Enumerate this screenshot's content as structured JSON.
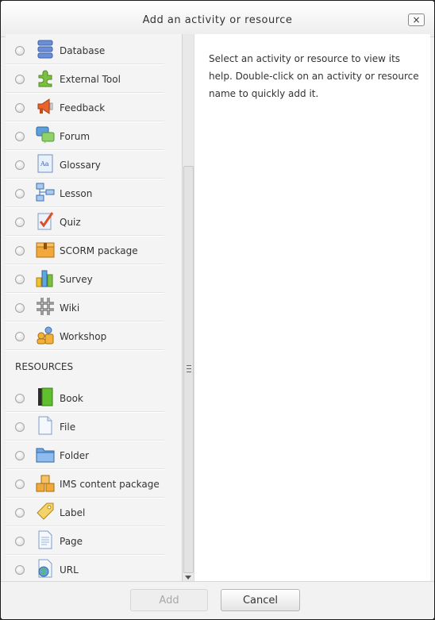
{
  "dialog": {
    "title": "Add an activity or resource",
    "close_label": "×"
  },
  "activities": [
    {
      "label": "Database",
      "icon": "database-icon"
    },
    {
      "label": "External Tool",
      "icon": "puzzle-icon"
    },
    {
      "label": "Feedback",
      "icon": "megaphone-icon"
    },
    {
      "label": "Forum",
      "icon": "speech-bubbles-icon"
    },
    {
      "label": "Glossary",
      "icon": "dictionary-icon"
    },
    {
      "label": "Lesson",
      "icon": "flowchart-icon"
    },
    {
      "label": "Quiz",
      "icon": "checkmark-paper-icon"
    },
    {
      "label": "SCORM package",
      "icon": "package-icon"
    },
    {
      "label": "Survey",
      "icon": "bar-chart-icon"
    },
    {
      "label": "Wiki",
      "icon": "wiki-hash-icon"
    },
    {
      "label": "Workshop",
      "icon": "people-icon"
    }
  ],
  "resources_heading": "RESOURCES",
  "resources": [
    {
      "label": "Book",
      "icon": "book-icon"
    },
    {
      "label": "File",
      "icon": "file-icon"
    },
    {
      "label": "Folder",
      "icon": "folder-icon"
    },
    {
      "label": "IMS content package",
      "icon": "boxes-icon"
    },
    {
      "label": "Label",
      "icon": "tag-icon"
    },
    {
      "label": "Page",
      "icon": "page-icon"
    },
    {
      "label": "URL",
      "icon": "globe-icon"
    }
  ],
  "help": {
    "text": "Select an activity or resource to view its help. Double-click on an activity or resource name to quickly add it."
  },
  "footer": {
    "add_label": "Add",
    "cancel_label": "Cancel"
  }
}
